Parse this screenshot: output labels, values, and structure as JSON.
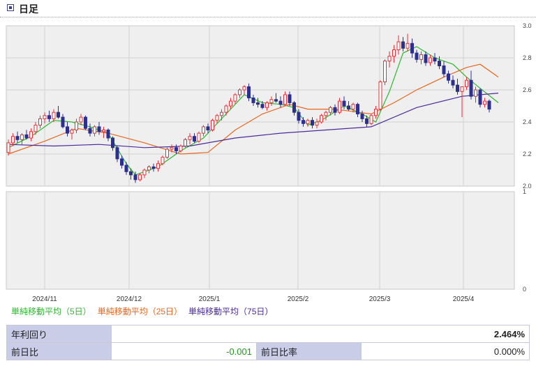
{
  "header": {
    "title": "日足"
  },
  "legend": {
    "ma5": "単純移動平均（5日）",
    "ma25": "単純移動平均（25日）",
    "ma75": "単純移動平均（75日）"
  },
  "info": {
    "yield_label": "年利回り",
    "yield_value": "2.464%",
    "change_label": "前日比",
    "change_value": "-0.001",
    "change_rate_label": "前日比率",
    "change_rate_value": "0.000%"
  },
  "colors": {
    "up": "#e0333b",
    "down": "#2b2f8f",
    "ma5": "#2db82d",
    "ma25": "#e8661c",
    "ma75": "#4a2a9a"
  },
  "chart_data": [
    {
      "type": "candlestick",
      "yticks": [
        "3.0",
        "2.8",
        "2.6",
        "2.4",
        "2.2",
        "2.0"
      ],
      "ylim": [
        2.0,
        3.0
      ],
      "xticks": [
        "2024/11",
        "2024/12",
        "2025/1",
        "2025/2",
        "2025/3",
        "2025/4"
      ],
      "grid": true,
      "candles_ohlc": [
        [
          2.21,
          2.29,
          2.19,
          2.27
        ],
        [
          2.27,
          2.33,
          2.25,
          2.31
        ],
        [
          2.31,
          2.34,
          2.27,
          2.29
        ],
        [
          2.29,
          2.33,
          2.26,
          2.32
        ],
        [
          2.32,
          2.35,
          2.29,
          2.3
        ],
        [
          2.3,
          2.36,
          2.28,
          2.34
        ],
        [
          2.34,
          2.4,
          2.32,
          2.38
        ],
        [
          2.38,
          2.44,
          2.36,
          2.42
        ],
        [
          2.42,
          2.46,
          2.39,
          2.44
        ],
        [
          2.44,
          2.47,
          2.4,
          2.42
        ],
        [
          2.42,
          2.48,
          2.4,
          2.46
        ],
        [
          2.46,
          2.5,
          2.42,
          2.43
        ],
        [
          2.43,
          2.45,
          2.36,
          2.37
        ],
        [
          2.37,
          2.4,
          2.31,
          2.33
        ],
        [
          2.33,
          2.36,
          2.29,
          2.35
        ],
        [
          2.35,
          2.42,
          2.33,
          2.4
        ],
        [
          2.4,
          2.45,
          2.38,
          2.43
        ],
        [
          2.43,
          2.44,
          2.35,
          2.36
        ],
        [
          2.36,
          2.39,
          2.31,
          2.33
        ],
        [
          2.33,
          2.38,
          2.31,
          2.37
        ],
        [
          2.37,
          2.4,
          2.32,
          2.34
        ],
        [
          2.34,
          2.37,
          2.3,
          2.35
        ],
        [
          2.35,
          2.36,
          2.28,
          2.3
        ],
        [
          2.3,
          2.31,
          2.22,
          2.24
        ],
        [
          2.24,
          2.25,
          2.15,
          2.17
        ],
        [
          2.17,
          2.19,
          2.11,
          2.13
        ],
        [
          2.13,
          2.15,
          2.07,
          2.09
        ],
        [
          2.09,
          2.11,
          2.04,
          2.07
        ],
        [
          2.07,
          2.09,
          2.02,
          2.04
        ],
        [
          2.04,
          2.08,
          2.03,
          2.07
        ],
        [
          2.07,
          2.11,
          2.05,
          2.1
        ],
        [
          2.1,
          2.13,
          2.08,
          2.12
        ],
        [
          2.12,
          2.14,
          2.09,
          2.11
        ],
        [
          2.11,
          2.16,
          2.09,
          2.14
        ],
        [
          2.14,
          2.19,
          2.13,
          2.18
        ],
        [
          2.18,
          2.24,
          2.17,
          2.23
        ],
        [
          2.23,
          2.26,
          2.21,
          2.24
        ],
        [
          2.24,
          2.26,
          2.2,
          2.22
        ],
        [
          2.22,
          2.26,
          2.21,
          2.25
        ],
        [
          2.25,
          2.3,
          2.24,
          2.29
        ],
        [
          2.29,
          2.33,
          2.26,
          2.31
        ],
        [
          2.31,
          2.33,
          2.27,
          2.28
        ],
        [
          2.28,
          2.34,
          2.27,
          2.33
        ],
        [
          2.33,
          2.38,
          2.31,
          2.37
        ],
        [
          2.37,
          2.39,
          2.33,
          2.35
        ],
        [
          2.35,
          2.42,
          2.34,
          2.41
        ],
        [
          2.41,
          2.45,
          2.39,
          2.44
        ],
        [
          2.44,
          2.48,
          2.41,
          2.46
        ],
        [
          2.46,
          2.51,
          2.44,
          2.5
        ],
        [
          2.5,
          2.55,
          2.48,
          2.53
        ],
        [
          2.53,
          2.58,
          2.51,
          2.57
        ],
        [
          2.57,
          2.61,
          2.55,
          2.6
        ],
        [
          2.6,
          2.63,
          2.57,
          2.62
        ],
        [
          2.62,
          2.64,
          2.53,
          2.55
        ],
        [
          2.55,
          2.57,
          2.5,
          2.52
        ],
        [
          2.52,
          2.55,
          2.49,
          2.51
        ],
        [
          2.51,
          2.53,
          2.48,
          2.49
        ],
        [
          2.49,
          2.53,
          2.47,
          2.52
        ],
        [
          2.52,
          2.56,
          2.5,
          2.54
        ],
        [
          2.54,
          2.58,
          2.52,
          2.53
        ],
        [
          2.53,
          2.56,
          2.49,
          2.51
        ],
        [
          2.51,
          2.59,
          2.5,
          2.57
        ],
        [
          2.57,
          2.59,
          2.5,
          2.52
        ],
        [
          2.52,
          2.53,
          2.44,
          2.46
        ],
        [
          2.46,
          2.48,
          2.39,
          2.41
        ],
        [
          2.41,
          2.43,
          2.37,
          2.39
        ],
        [
          2.39,
          2.42,
          2.37,
          2.41
        ],
        [
          2.41,
          2.43,
          2.36,
          2.38
        ],
        [
          2.38,
          2.42,
          2.36,
          2.4
        ],
        [
          2.4,
          2.45,
          2.39,
          2.44
        ],
        [
          2.44,
          2.47,
          2.41,
          2.46
        ],
        [
          2.46,
          2.5,
          2.44,
          2.49
        ],
        [
          2.49,
          2.51,
          2.44,
          2.46
        ],
        [
          2.46,
          2.55,
          2.45,
          2.53
        ],
        [
          2.53,
          2.56,
          2.48,
          2.5
        ],
        [
          2.5,
          2.53,
          2.47,
          2.48
        ],
        [
          2.48,
          2.52,
          2.46,
          2.51
        ],
        [
          2.51,
          2.52,
          2.43,
          2.45
        ],
        [
          2.45,
          2.47,
          2.4,
          2.42
        ],
        [
          2.42,
          2.44,
          2.37,
          2.39
        ],
        [
          2.39,
          2.45,
          2.38,
          2.44
        ],
        [
          2.44,
          2.5,
          2.42,
          2.48
        ],
        [
          2.48,
          2.66,
          2.47,
          2.65
        ],
        [
          2.65,
          2.79,
          2.63,
          2.78
        ],
        [
          2.78,
          2.84,
          2.74,
          2.81
        ],
        [
          2.81,
          2.88,
          2.77,
          2.85
        ],
        [
          2.85,
          2.94,
          2.82,
          2.9
        ],
        [
          2.9,
          2.93,
          2.84,
          2.86
        ],
        [
          2.86,
          2.95,
          2.84,
          2.89
        ],
        [
          2.89,
          2.92,
          2.8,
          2.83
        ],
        [
          2.83,
          2.85,
          2.77,
          2.79
        ],
        [
          2.79,
          2.84,
          2.76,
          2.82
        ],
        [
          2.82,
          2.84,
          2.75,
          2.77
        ],
        [
          2.77,
          2.82,
          2.75,
          2.8
        ],
        [
          2.8,
          2.83,
          2.76,
          2.78
        ],
        [
          2.78,
          2.81,
          2.73,
          2.75
        ],
        [
          2.75,
          2.78,
          2.68,
          2.7
        ],
        [
          2.7,
          2.72,
          2.64,
          2.66
        ],
        [
          2.66,
          2.69,
          2.61,
          2.63
        ],
        [
          2.63,
          2.67,
          2.57,
          2.59
        ],
        [
          2.59,
          2.6,
          2.43,
          2.62
        ],
        [
          2.62,
          2.68,
          2.6,
          2.66
        ],
        [
          2.66,
          2.72,
          2.54,
          2.56
        ],
        [
          2.56,
          2.62,
          2.52,
          2.6
        ],
        [
          2.6,
          2.61,
          2.49,
          2.51
        ],
        [
          2.51,
          2.55,
          2.49,
          2.53
        ],
        [
          2.53,
          2.54,
          2.46,
          2.48
        ]
      ],
      "series": [
        {
          "name": "単純移動平均（5日）",
          "color_key": "ma5",
          "points": [
            [
              0,
              2.24
            ],
            [
              5,
              2.31
            ],
            [
              10,
              2.41
            ],
            [
              14,
              2.4
            ],
            [
              18,
              2.37
            ],
            [
              22,
              2.33
            ],
            [
              26,
              2.14
            ],
            [
              28,
              2.07
            ],
            [
              33,
              2.12
            ],
            [
              38,
              2.22
            ],
            [
              43,
              2.3
            ],
            [
              48,
              2.45
            ],
            [
              52,
              2.57
            ],
            [
              56,
              2.52
            ],
            [
              60,
              2.51
            ],
            [
              63,
              2.49
            ],
            [
              66,
              2.38
            ],
            [
              69,
              2.41
            ],
            [
              74,
              2.5
            ],
            [
              78,
              2.45
            ],
            [
              81,
              2.4
            ],
            [
              84,
              2.59
            ],
            [
              87,
              2.83
            ],
            [
              90,
              2.87
            ],
            [
              94,
              2.8
            ],
            [
              98,
              2.76
            ],
            [
              101,
              2.68
            ],
            [
              104,
              2.61
            ],
            [
              108,
              2.52
            ]
          ]
        },
        {
          "name": "単純移動平均（25日）",
          "color_key": "ma25",
          "points": [
            [
              0,
              2.2
            ],
            [
              8,
              2.28
            ],
            [
              15,
              2.36
            ],
            [
              22,
              2.33
            ],
            [
              30,
              2.27
            ],
            [
              38,
              2.2
            ],
            [
              44,
              2.21
            ],
            [
              50,
              2.35
            ],
            [
              56,
              2.45
            ],
            [
              62,
              2.51
            ],
            [
              66,
              2.48
            ],
            [
              72,
              2.48
            ],
            [
              80,
              2.45
            ],
            [
              85,
              2.52
            ],
            [
              90,
              2.6
            ],
            [
              96,
              2.68
            ],
            [
              101,
              2.74
            ],
            [
              104,
              2.76
            ],
            [
              108,
              2.68
            ]
          ]
        },
        {
          "name": "単純移動平均（75日）",
          "color_key": "ma75",
          "points": [
            [
              0,
              2.26
            ],
            [
              10,
              2.25
            ],
            [
              20,
              2.26
            ],
            [
              30,
              2.24
            ],
            [
              40,
              2.25
            ],
            [
              50,
              2.3
            ],
            [
              60,
              2.33
            ],
            [
              70,
              2.35
            ],
            [
              80,
              2.37
            ],
            [
              90,
              2.49
            ],
            [
              100,
              2.56
            ],
            [
              108,
              2.58
            ]
          ]
        }
      ]
    },
    {
      "type": "bar",
      "yticks": [
        "1",
        "0"
      ],
      "ylim": [
        0,
        1
      ],
      "xticks": [
        "2024/11",
        "2024/12",
        "2025/1",
        "2025/2",
        "2025/3",
        "2025/4"
      ],
      "values": []
    }
  ]
}
